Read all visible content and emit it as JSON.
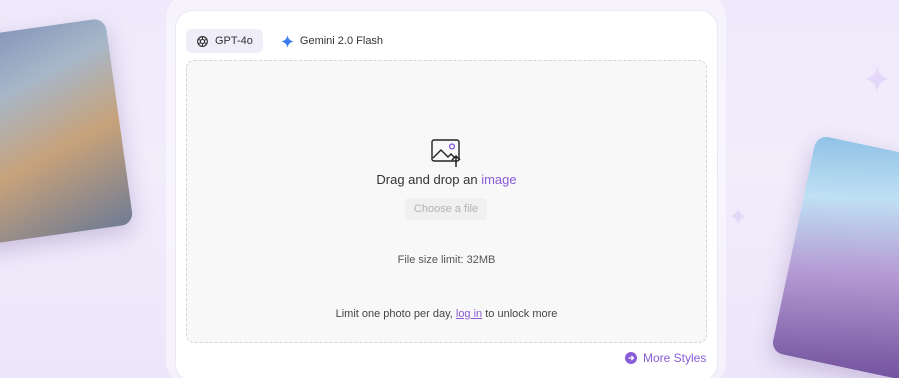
{
  "tabs": [
    {
      "label": "GPT-4o",
      "icon": "openai-icon",
      "active": true
    },
    {
      "label": "Gemini 2.0 Flash",
      "icon": "gemini-star-icon",
      "active": false
    }
  ],
  "dropzone": {
    "icon": "image-upload-icon",
    "prompt_prefix": "Drag and drop an",
    "prompt_accent": "image",
    "choose_button": "Choose a file",
    "size_limit": "File size limit: 32MB",
    "note_prefix": "Limit one photo per day,",
    "note_link": "log in",
    "note_suffix": "to unlock more"
  },
  "more_styles": {
    "label": "More Styles",
    "icon": "arrow-right-circle-icon"
  },
  "colors": {
    "accent": "#8a5cd6",
    "background": "#efeafb",
    "gemini_blue": "#3a7bf0"
  }
}
